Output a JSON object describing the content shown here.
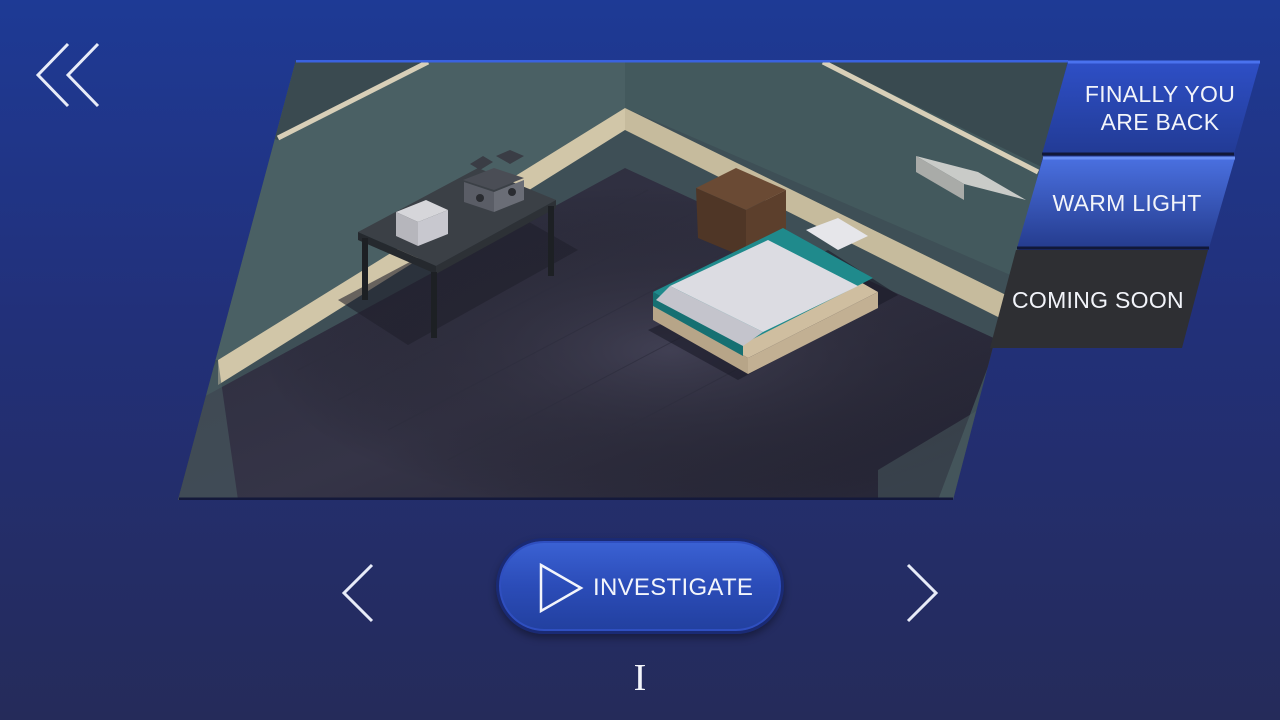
{
  "levels": [
    {
      "label": "FINALLY YOU\nARE BACK",
      "state": "available"
    },
    {
      "label": "WARM LIGHT",
      "state": "selected"
    },
    {
      "label": "COMING SOON",
      "state": "locked"
    }
  ],
  "play_button": {
    "label": "INVESTIGATE"
  },
  "page_indicator": "I",
  "colors": {
    "background_top": "#1e3a95",
    "background_bottom": "#252b5a",
    "tab_available": "#2c4cc0",
    "tab_selected": "#3a5cd0",
    "tab_locked": "#2e2f33",
    "accent_border": "#3a62e0"
  },
  "icons": {
    "back": "double-chevron-left",
    "prev": "chevron-left",
    "next": "chevron-right",
    "play": "play-triangle"
  }
}
